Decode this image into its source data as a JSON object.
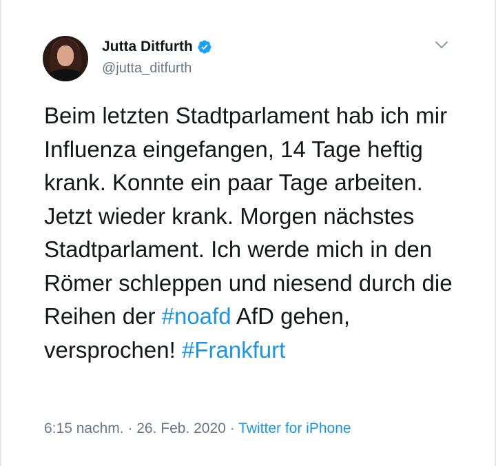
{
  "author": {
    "display_name": "Jutta Ditfurth",
    "handle": "@jutta_ditfurth",
    "verified": true
  },
  "tweet": {
    "segments": [
      {
        "text": "Beim letzten Stadtparlament hab ich mir Influenza eingefangen, 14 Tage heftig krank. Konnte ein paar Tage arbeiten. Jetzt wieder krank. Morgen nächstes Stadtparlament. Ich werde mich in den Römer schleppen und niesend durch die Reihen der ",
        "type": "text"
      },
      {
        "text": "#noafd",
        "type": "hashtag"
      },
      {
        "text": " AfD gehen, versprochen! ",
        "type": "text"
      },
      {
        "text": "#Frankfurt",
        "type": "hashtag"
      }
    ],
    "time": "6:15 nachm.",
    "separator": " · ",
    "date": "26. Feb. 2020",
    "source": "Twitter for iPhone"
  },
  "icons": {
    "verified": "verified-badge-icon",
    "menu": "chevron-down-icon"
  },
  "colors": {
    "text": "#14171a",
    "secondary": "#657786",
    "link": "#1b95e0",
    "verified": "#1da1f2"
  }
}
